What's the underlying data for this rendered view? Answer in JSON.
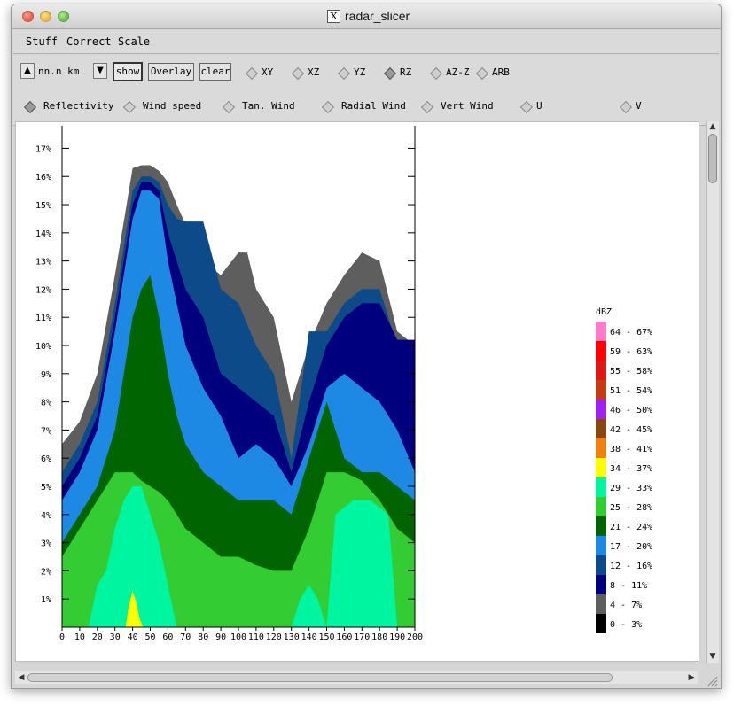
{
  "window": {
    "title": "radar_slicer"
  },
  "menu": [
    "Stuff",
    "Correct",
    "Scale"
  ],
  "toolbar": {
    "height_label": "nn.n km",
    "show_label": "show",
    "overlay_label": "Overlay",
    "clear_label": "clear",
    "views": [
      {
        "label": "XY",
        "selected": false
      },
      {
        "label": "XZ",
        "selected": false
      },
      {
        "label": "YZ",
        "selected": false
      },
      {
        "label": "RZ",
        "selected": true
      },
      {
        "label": "AZ-Z",
        "selected": false
      },
      {
        "label": "ARB",
        "selected": false
      }
    ],
    "fields": [
      {
        "label": "Reflectivity",
        "selected": true
      },
      {
        "label": "Wind speed",
        "selected": false
      },
      {
        "label": "Tan. Wind",
        "selected": false
      },
      {
        "label": "Radial Wind",
        "selected": false
      },
      {
        "label": "Vert Wind",
        "selected": false
      },
      {
        "label": "U",
        "selected": false
      },
      {
        "label": "V",
        "selected": false
      }
    ]
  },
  "chart_data": {
    "type": "heatmap",
    "title": "",
    "xlabel": "",
    "ylabel": "",
    "x_ticks": [
      "0",
      "10",
      "20",
      "30",
      "40",
      "50",
      "60",
      "70",
      "80",
      "90",
      "100",
      "110",
      "120",
      "130",
      "140",
      "150",
      "160",
      "170",
      "180",
      "190",
      "200"
    ],
    "y_ticks": [
      "1%",
      "2%",
      "3%",
      "4%",
      "5%",
      "6%",
      "7%",
      "8%",
      "9%",
      "10%",
      "11%",
      "12%",
      "13%",
      "14%",
      "15%",
      "16%",
      "17%"
    ],
    "xlim": [
      0,
      200
    ],
    "ylim": [
      0,
      17.8
    ],
    "legend": {
      "title": "dBZ",
      "entries": [
        {
          "label": "64 - 67%",
          "color": "#ff7ac8"
        },
        {
          "label": "59 - 63%",
          "color": "#ff0000"
        },
        {
          "label": "55 - 58%",
          "color": "#dd1616"
        },
        {
          "label": "51 - 54%",
          "color": "#c43a12"
        },
        {
          "label": "46 - 50%",
          "color": "#a020f0"
        },
        {
          "label": "42 - 45%",
          "color": "#8b4513"
        },
        {
          "label": "38 - 41%",
          "color": "#f08010"
        },
        {
          "label": "34 - 37%",
          "color": "#ffff00"
        },
        {
          "label": "29 - 33%",
          "color": "#00f5a0"
        },
        {
          "label": "25 - 28%",
          "color": "#33cc33"
        },
        {
          "label": "21 - 24%",
          "color": "#006400"
        },
        {
          "label": "17 - 20%",
          "color": "#1e88e5"
        },
        {
          "label": "12 - 16%",
          "color": "#0c4a8a"
        },
        {
          "label": "8 - 11%",
          "color": "#00007e"
        },
        {
          "label": "4 - 7%",
          "color": "#5e5e5e"
        },
        {
          "label": "0 - 3%",
          "color": "#000000"
        }
      ]
    },
    "layers": [
      {
        "label": "4 - 7%",
        "color": "#5e5e5e",
        "cols": [
          [
            0,
            6.5
          ],
          [
            10,
            7.3
          ],
          [
            20,
            9.0
          ],
          [
            30,
            12.5
          ],
          [
            40,
            16.3
          ],
          [
            45,
            16.4
          ],
          [
            50,
            16.4
          ],
          [
            55,
            16.2
          ],
          [
            60,
            15.8
          ],
          [
            65,
            15.0
          ],
          [
            70,
            14.3
          ],
          [
            80,
            13.0
          ],
          [
            90,
            12.5
          ],
          [
            100,
            13.3
          ],
          [
            105,
            13.3
          ],
          [
            110,
            12.0
          ],
          [
            120,
            11.0
          ],
          [
            130,
            8.0
          ],
          [
            140,
            10.0
          ],
          [
            150,
            11.5
          ],
          [
            160,
            12.5
          ],
          [
            170,
            13.3
          ],
          [
            180,
            13.0
          ],
          [
            190,
            10.5
          ],
          [
            200,
            10.0
          ]
        ]
      },
      {
        "label": "12 - 16%",
        "color": "#0c4a8a",
        "cols": [
          [
            0,
            5.5
          ],
          [
            10,
            6.5
          ],
          [
            20,
            8.0
          ],
          [
            30,
            11.5
          ],
          [
            40,
            15.5
          ],
          [
            45,
            16.0
          ],
          [
            50,
            16.0
          ],
          [
            55,
            15.8
          ],
          [
            60,
            15.0
          ],
          [
            65,
            14.5
          ],
          [
            70,
            14.4
          ],
          [
            80,
            14.4
          ],
          [
            90,
            12.0
          ],
          [
            100,
            11.5
          ],
          [
            110,
            10.0
          ],
          [
            120,
            9.0
          ],
          [
            130,
            6.0
          ],
          [
            140,
            10.5
          ],
          [
            150,
            10.5
          ],
          [
            160,
            11.5
          ],
          [
            170,
            12.0
          ],
          [
            180,
            12.0
          ],
          [
            190,
            10.0
          ],
          [
            200,
            9.5
          ]
        ]
      },
      {
        "label": "8 - 11%",
        "color": "#00007e",
        "cols": [
          [
            0,
            5.0
          ],
          [
            10,
            6.0
          ],
          [
            20,
            7.5
          ],
          [
            30,
            11.0
          ],
          [
            40,
            15.0
          ],
          [
            45,
            15.8
          ],
          [
            50,
            15.8
          ],
          [
            55,
            15.5
          ],
          [
            60,
            14.0
          ],
          [
            65,
            13.0
          ],
          [
            70,
            12.0
          ],
          [
            80,
            11.0
          ],
          [
            90,
            9.0
          ],
          [
            100,
            8.5
          ],
          [
            110,
            8.0
          ],
          [
            120,
            7.5
          ],
          [
            130,
            5.5
          ],
          [
            140,
            8.0
          ],
          [
            150,
            10.0
          ],
          [
            160,
            11.0
          ],
          [
            170,
            11.5
          ],
          [
            180,
            11.5
          ],
          [
            190,
            10.2
          ],
          [
            200,
            10.2
          ]
        ]
      },
      {
        "label": "17 - 20%",
        "color": "#1e88e5",
        "cols": [
          [
            0,
            4.5
          ],
          [
            10,
            5.5
          ],
          [
            20,
            7.0
          ],
          [
            30,
            10.5
          ],
          [
            40,
            14.5
          ],
          [
            45,
            15.5
          ],
          [
            50,
            15.5
          ],
          [
            55,
            15.2
          ],
          [
            60,
            13.0
          ],
          [
            65,
            11.5
          ],
          [
            70,
            10.0
          ],
          [
            80,
            8.5
          ],
          [
            90,
            7.5
          ],
          [
            100,
            6.0
          ],
          [
            110,
            6.5
          ],
          [
            120,
            6.0
          ],
          [
            130,
            5.0
          ],
          [
            140,
            6.5
          ],
          [
            150,
            8.5
          ],
          [
            160,
            9.0
          ],
          [
            170,
            8.5
          ],
          [
            180,
            8.0
          ],
          [
            190,
            7.0
          ],
          [
            200,
            5.5
          ]
        ]
      },
      {
        "label": "21 - 24%",
        "color": "#006400",
        "cols": [
          [
            0,
            3.0
          ],
          [
            10,
            4.0
          ],
          [
            20,
            5.0
          ],
          [
            30,
            7.0
          ],
          [
            40,
            11.0
          ],
          [
            45,
            12.0
          ],
          [
            50,
            12.5
          ],
          [
            55,
            11.0
          ],
          [
            60,
            9.0
          ],
          [
            65,
            7.5
          ],
          [
            70,
            6.5
          ],
          [
            80,
            5.5
          ],
          [
            90,
            5.0
          ],
          [
            100,
            4.5
          ],
          [
            110,
            4.5
          ],
          [
            120,
            4.5
          ],
          [
            130,
            4.0
          ],
          [
            140,
            6.0
          ],
          [
            150,
            8.0
          ],
          [
            160,
            6.0
          ],
          [
            170,
            5.5
          ],
          [
            180,
            5.5
          ],
          [
            190,
            5.0
          ],
          [
            200,
            4.5
          ]
        ]
      },
      {
        "label": "25 - 28%",
        "color": "#33cc33",
        "cols": [
          [
            0,
            2.5
          ],
          [
            10,
            3.5
          ],
          [
            20,
            4.5
          ],
          [
            30,
            5.5
          ],
          [
            40,
            5.5
          ],
          [
            45,
            5.2
          ],
          [
            50,
            5.0
          ],
          [
            55,
            4.8
          ],
          [
            60,
            4.5
          ],
          [
            65,
            4.0
          ],
          [
            70,
            3.5
          ],
          [
            80,
            3.0
          ],
          [
            90,
            2.5
          ],
          [
            100,
            2.5
          ],
          [
            110,
            2.2
          ],
          [
            120,
            2.0
          ],
          [
            130,
            2.0
          ],
          [
            140,
            3.5
          ],
          [
            150,
            5.5
          ],
          [
            160,
            5.5
          ],
          [
            170,
            5.2
          ],
          [
            180,
            4.5
          ],
          [
            190,
            3.5
          ],
          [
            200,
            3.0
          ]
        ]
      },
      {
        "label": "29 - 33%",
        "color": "#00f5a0",
        "cols": [
          [
            0,
            0
          ],
          [
            15,
            0
          ],
          [
            20,
            1.5
          ],
          [
            25,
            2.0
          ],
          [
            30,
            3.5
          ],
          [
            35,
            4.5
          ],
          [
            40,
            5.0
          ],
          [
            45,
            5.0
          ],
          [
            50,
            4.0
          ],
          [
            55,
            3.0
          ],
          [
            60,
            1.5
          ],
          [
            65,
            0
          ],
          [
            130,
            0
          ],
          [
            135,
            1.0
          ],
          [
            140,
            1.5
          ],
          [
            145,
            1.0
          ],
          [
            150,
            0
          ],
          [
            155,
            4.0
          ],
          [
            165,
            4.5
          ],
          [
            175,
            4.5
          ],
          [
            185,
            4.0
          ],
          [
            190,
            0
          ],
          [
            200,
            0
          ]
        ]
      },
      {
        "label": "34 - 37%",
        "color": "#ffff00",
        "cols": [
          [
            0,
            0
          ],
          [
            36,
            0
          ],
          [
            38,
            0.8
          ],
          [
            40,
            1.3
          ],
          [
            42,
            0.9
          ],
          [
            44,
            0.3
          ],
          [
            46,
            0
          ],
          [
            200,
            0
          ]
        ]
      }
    ]
  }
}
